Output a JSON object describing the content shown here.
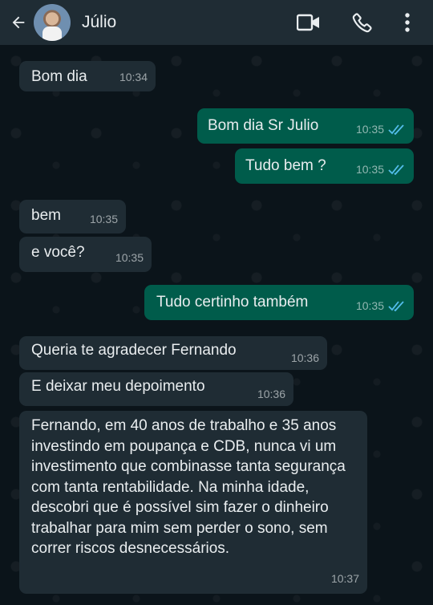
{
  "header": {
    "contact_name": "Júlio"
  },
  "messages": [
    {
      "text": "Bom dia",
      "time": "10:34",
      "direction": "in"
    },
    {
      "text": "Bom dia Sr Julio",
      "time": "10:35",
      "direction": "out",
      "status": "read"
    },
    {
      "text": "Tudo bem ?",
      "time": "10:35",
      "direction": "out",
      "status": "read"
    },
    {
      "text": "bem",
      "time": "10:35",
      "direction": "in"
    },
    {
      "text": "e você?",
      "time": "10:35",
      "direction": "in"
    },
    {
      "text": "Tudo certinho também",
      "time": "10:35",
      "direction": "out",
      "status": "read"
    },
    {
      "text": "Queria te agradecer Fernando",
      "time": "10:36",
      "direction": "in"
    },
    {
      "text": "E deixar meu depoimento",
      "time": "10:36",
      "direction": "in"
    },
    {
      "text": "Fernando, em 40 anos de trabalho e 35 anos investindo em poupança e CDB, nunca vi um investimento que combinasse tanta segurança com tanta rentabilidade. Na minha idade, descobri que é possível sim fazer o dinheiro trabalhar para mim sem perder o sono, sem correr riscos desnecessários.",
      "time": "10:37",
      "direction": "in"
    }
  ],
  "colors": {
    "header_bg": "#1f2c34",
    "chat_bg": "#0b141a",
    "incoming_bubble": "#1f2c34",
    "outgoing_bubble": "#005c4b",
    "read_ticks": "#53bdeb"
  },
  "icons": [
    "back-arrow-icon",
    "video-call-icon",
    "phone-icon",
    "more-options-icon",
    "double-check-icon"
  ]
}
